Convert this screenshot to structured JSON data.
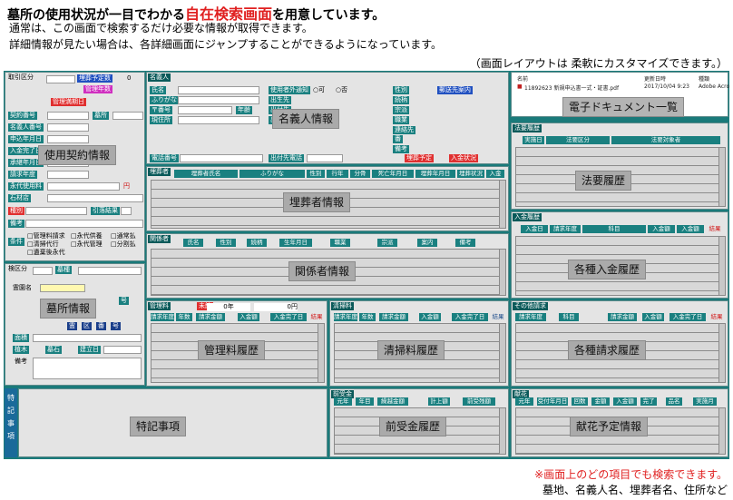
{
  "header": {
    "title_pre": "墓所の使用状況が一目でわかる",
    "title_emph": "自在検索画面",
    "title_post": "を用意しています。",
    "line1": "通常は、この画面で検索するだけ必要な情報が取得できます。",
    "line2": "詳細情報が見たい場合は、各詳細画面にジャンプすることができるようになっています。",
    "layout_note": "（画面レイアウトは 柔軟にカスタマイズできます。）"
  },
  "footer": {
    "note1": "※画面上のどの項目でも検索できます。",
    "note2": "墓地、名義人名、埋葬者名、住所など"
  },
  "contract": {
    "overlay": "使用契約情報",
    "labels": [
      "取引区分",
      "埋葬予定数",
      "管理年数",
      "管理満期日",
      "契約番号",
      "墓所",
      "名義人番号",
      "申込年月日",
      "入金完了日",
      "承継年月日",
      "請求年度",
      "永代使用料",
      "石材店",
      "種別",
      "備考",
      "条件"
    ],
    "count_value": "0",
    "unit": "円",
    "ref_label": "引落結果",
    "conditions": [
      "□管理料請求",
      "□永代供養",
      "□通常払",
      "□清掃代行",
      "□永代管理",
      "□分割払",
      "□遺棄後永代"
    ]
  },
  "nominee": {
    "overlay": "名義人情報",
    "labels": [
      "名義人",
      "氏名",
      "ふりがな",
      "〒番号",
      "現住所",
      "電話番号",
      "使用者外通知",
      "出生先",
      "出付先",
      "性別",
      "続柄",
      "宗派",
      "職業",
      "連絡先",
      "番",
      "備考",
      "年齢",
      "出付先電話",
      "埋葬予定",
      "入金状況"
    ],
    "radio_yes": "○可",
    "radio_no": "○否",
    "select_label": "郵送先案内"
  },
  "edocs": {
    "overlay": "電子ドキュメント一覧",
    "col_name": "名前",
    "col_date": "更新日時",
    "col_kind": "種類",
    "row_name": "11892623 新規申込書一式・証書.pdf",
    "row_date": "2017/10/04 9:23",
    "row_kind": "Adobe Acro"
  },
  "hoyo": {
    "title": "法要履歴",
    "overlay": "法要履歴",
    "columns": [
      "実施日",
      "法要区分",
      "法要対象者"
    ]
  },
  "burial": {
    "title": "埋葬者",
    "overlay": "埋葬者情報",
    "columns": [
      "埋葬者氏名",
      "ふりがな",
      "性別",
      "行年",
      "分骨",
      "死亡年月日",
      "埋葬年月日",
      "埋葬状況",
      "入金"
    ]
  },
  "payments": {
    "title": "入金履歴",
    "overlay": "各種入金履歴",
    "columns": [
      "入金日",
      "請求年度",
      "科目",
      "入金額",
      "入金額",
      "結果"
    ]
  },
  "relation": {
    "title": "関係者",
    "overlay": "関係者情報",
    "columns": [
      "氏名",
      "性別",
      "続柄",
      "生年月日",
      "職業",
      "宗派",
      "案内",
      "備考"
    ]
  },
  "grave": {
    "overlay": "墓所情報",
    "labels": [
      "検区分",
      "墓種",
      "霊園名",
      "号",
      "面積",
      "植木",
      "墓石",
      "建立日",
      "備考"
    ],
    "nav": [
      "霊",
      "区",
      "番",
      "号"
    ]
  },
  "mgmt": {
    "title": "管理料",
    "overlay": "管理料履歴",
    "unpaid": "未納",
    "years": "0年",
    "yen": "0円",
    "columns": [
      "請求年度",
      "年数",
      "請求金額",
      "入金額",
      "入金完了日",
      "結果"
    ]
  },
  "clean": {
    "title": "清掃料",
    "overlay": "清掃料履歴",
    "columns": [
      "請求年度",
      "年数",
      "請求金額",
      "入金額",
      "入金完了日",
      "結果"
    ]
  },
  "billing": {
    "title": "その他請求",
    "overlay": "各種請求履歴",
    "columns": [
      "請求年度",
      "科目",
      "請求金額",
      "入金額",
      "入金完了日",
      "結果"
    ]
  },
  "special": {
    "side": [
      "特",
      "記",
      "事",
      "項"
    ],
    "overlay": "特記事項"
  },
  "advance": {
    "title": "前受金",
    "overlay": "前受金履歴",
    "columns": [
      "元年",
      "年目",
      "繰越金額",
      "計上額",
      "前受残額"
    ]
  },
  "flower": {
    "title": "献花",
    "overlay": "献花予定情報",
    "columns": [
      "元年",
      "受付年月日",
      "回数",
      "金額",
      "入金額",
      "完了",
      "品名",
      "実施月"
    ]
  }
}
